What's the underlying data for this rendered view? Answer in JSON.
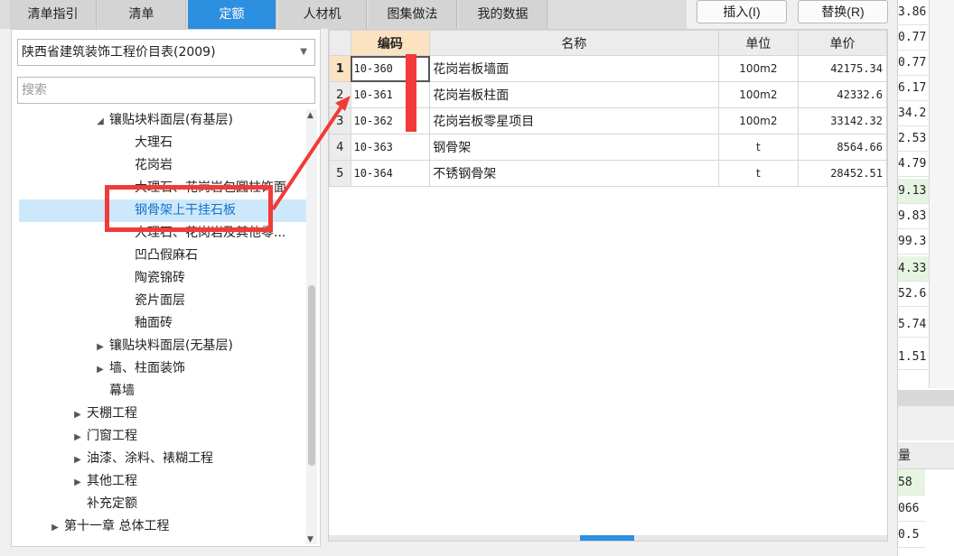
{
  "tabs": [
    {
      "label": "清单指引"
    },
    {
      "label": "清单"
    },
    {
      "label": "定额"
    },
    {
      "label": "人材机"
    },
    {
      "label": "图集做法"
    },
    {
      "label": "我的数据"
    }
  ],
  "toolbar": {
    "insert_label": "插入(I)",
    "replace_label": "替换(R)"
  },
  "left": {
    "dropdown_value": "陕西省建筑装饰工程价目表(2009)",
    "search_placeholder": "搜索",
    "tree": [
      {
        "label": "镶贴块料面层(有基层)",
        "arrow": "◢"
      },
      {
        "label": "大理石",
        "arrow": ""
      },
      {
        "label": "花岗岩",
        "arrow": ""
      },
      {
        "label": "大理石、花岗岩包圆柱饰面",
        "arrow": ""
      },
      {
        "label": "钢骨架上干挂石板",
        "arrow": ""
      },
      {
        "label": "大理石、花岗岩及其他零...",
        "arrow": ""
      },
      {
        "label": "凹凸假麻石",
        "arrow": ""
      },
      {
        "label": "陶瓷锦砖",
        "arrow": ""
      },
      {
        "label": "瓷片面层",
        "arrow": ""
      },
      {
        "label": "釉面砖",
        "arrow": ""
      },
      {
        "label": "镶贴块料面层(无基层)",
        "arrow": "▶"
      },
      {
        "label": "墙、柱面装饰",
        "arrow": "▶"
      },
      {
        "label": "幕墙",
        "arrow": ""
      },
      {
        "label": "天棚工程",
        "arrow": "▶"
      },
      {
        "label": "门窗工程",
        "arrow": "▶"
      },
      {
        "label": "油漆、涂料、裱糊工程",
        "arrow": "▶"
      },
      {
        "label": "其他工程",
        "arrow": "▶"
      },
      {
        "label": "补充定额",
        "arrow": ""
      },
      {
        "label": "第十一章 总体工程",
        "arrow": "▶"
      }
    ]
  },
  "grid": {
    "headers": {
      "code": "编码",
      "name": "名称",
      "unit": "单位",
      "price": "单价"
    },
    "rows": [
      {
        "idx": "1",
        "code": "10-360",
        "name": "花岗岩板墙面",
        "unit": "100m2",
        "price": "42175.34"
      },
      {
        "idx": "2",
        "code": "10-361",
        "name": "花岗岩板柱面",
        "unit": "100m2",
        "price": "42332.6"
      },
      {
        "idx": "3",
        "code": "10-362",
        "name": "花岗岩板零星项目",
        "unit": "100m2",
        "price": "33142.32"
      },
      {
        "idx": "4",
        "code": "10-363",
        "name": "钢骨架",
        "unit": "t",
        "price": "8564.66"
      },
      {
        "idx": "5",
        "code": "10-364",
        "name": "不锈钢骨架",
        "unit": "t",
        "price": "28452.51"
      }
    ]
  },
  "right": {
    "top_values": [
      "3.86",
      "0.77",
      "0.77",
      "6.17",
      "34.2",
      "2.53",
      "4.79",
      "9.13",
      "9.83",
      "99.3",
      "4.33",
      "52.6",
      "5.74",
      "1.51"
    ],
    "header": "量",
    "bottom_values": [
      "58",
      "066",
      "0.5"
    ]
  },
  "colors": {
    "accent": "#2d8fe0",
    "annotation": "#f23a3a",
    "selected_row": "#cde8fb",
    "sorted_header": "#fbe3c2"
  }
}
